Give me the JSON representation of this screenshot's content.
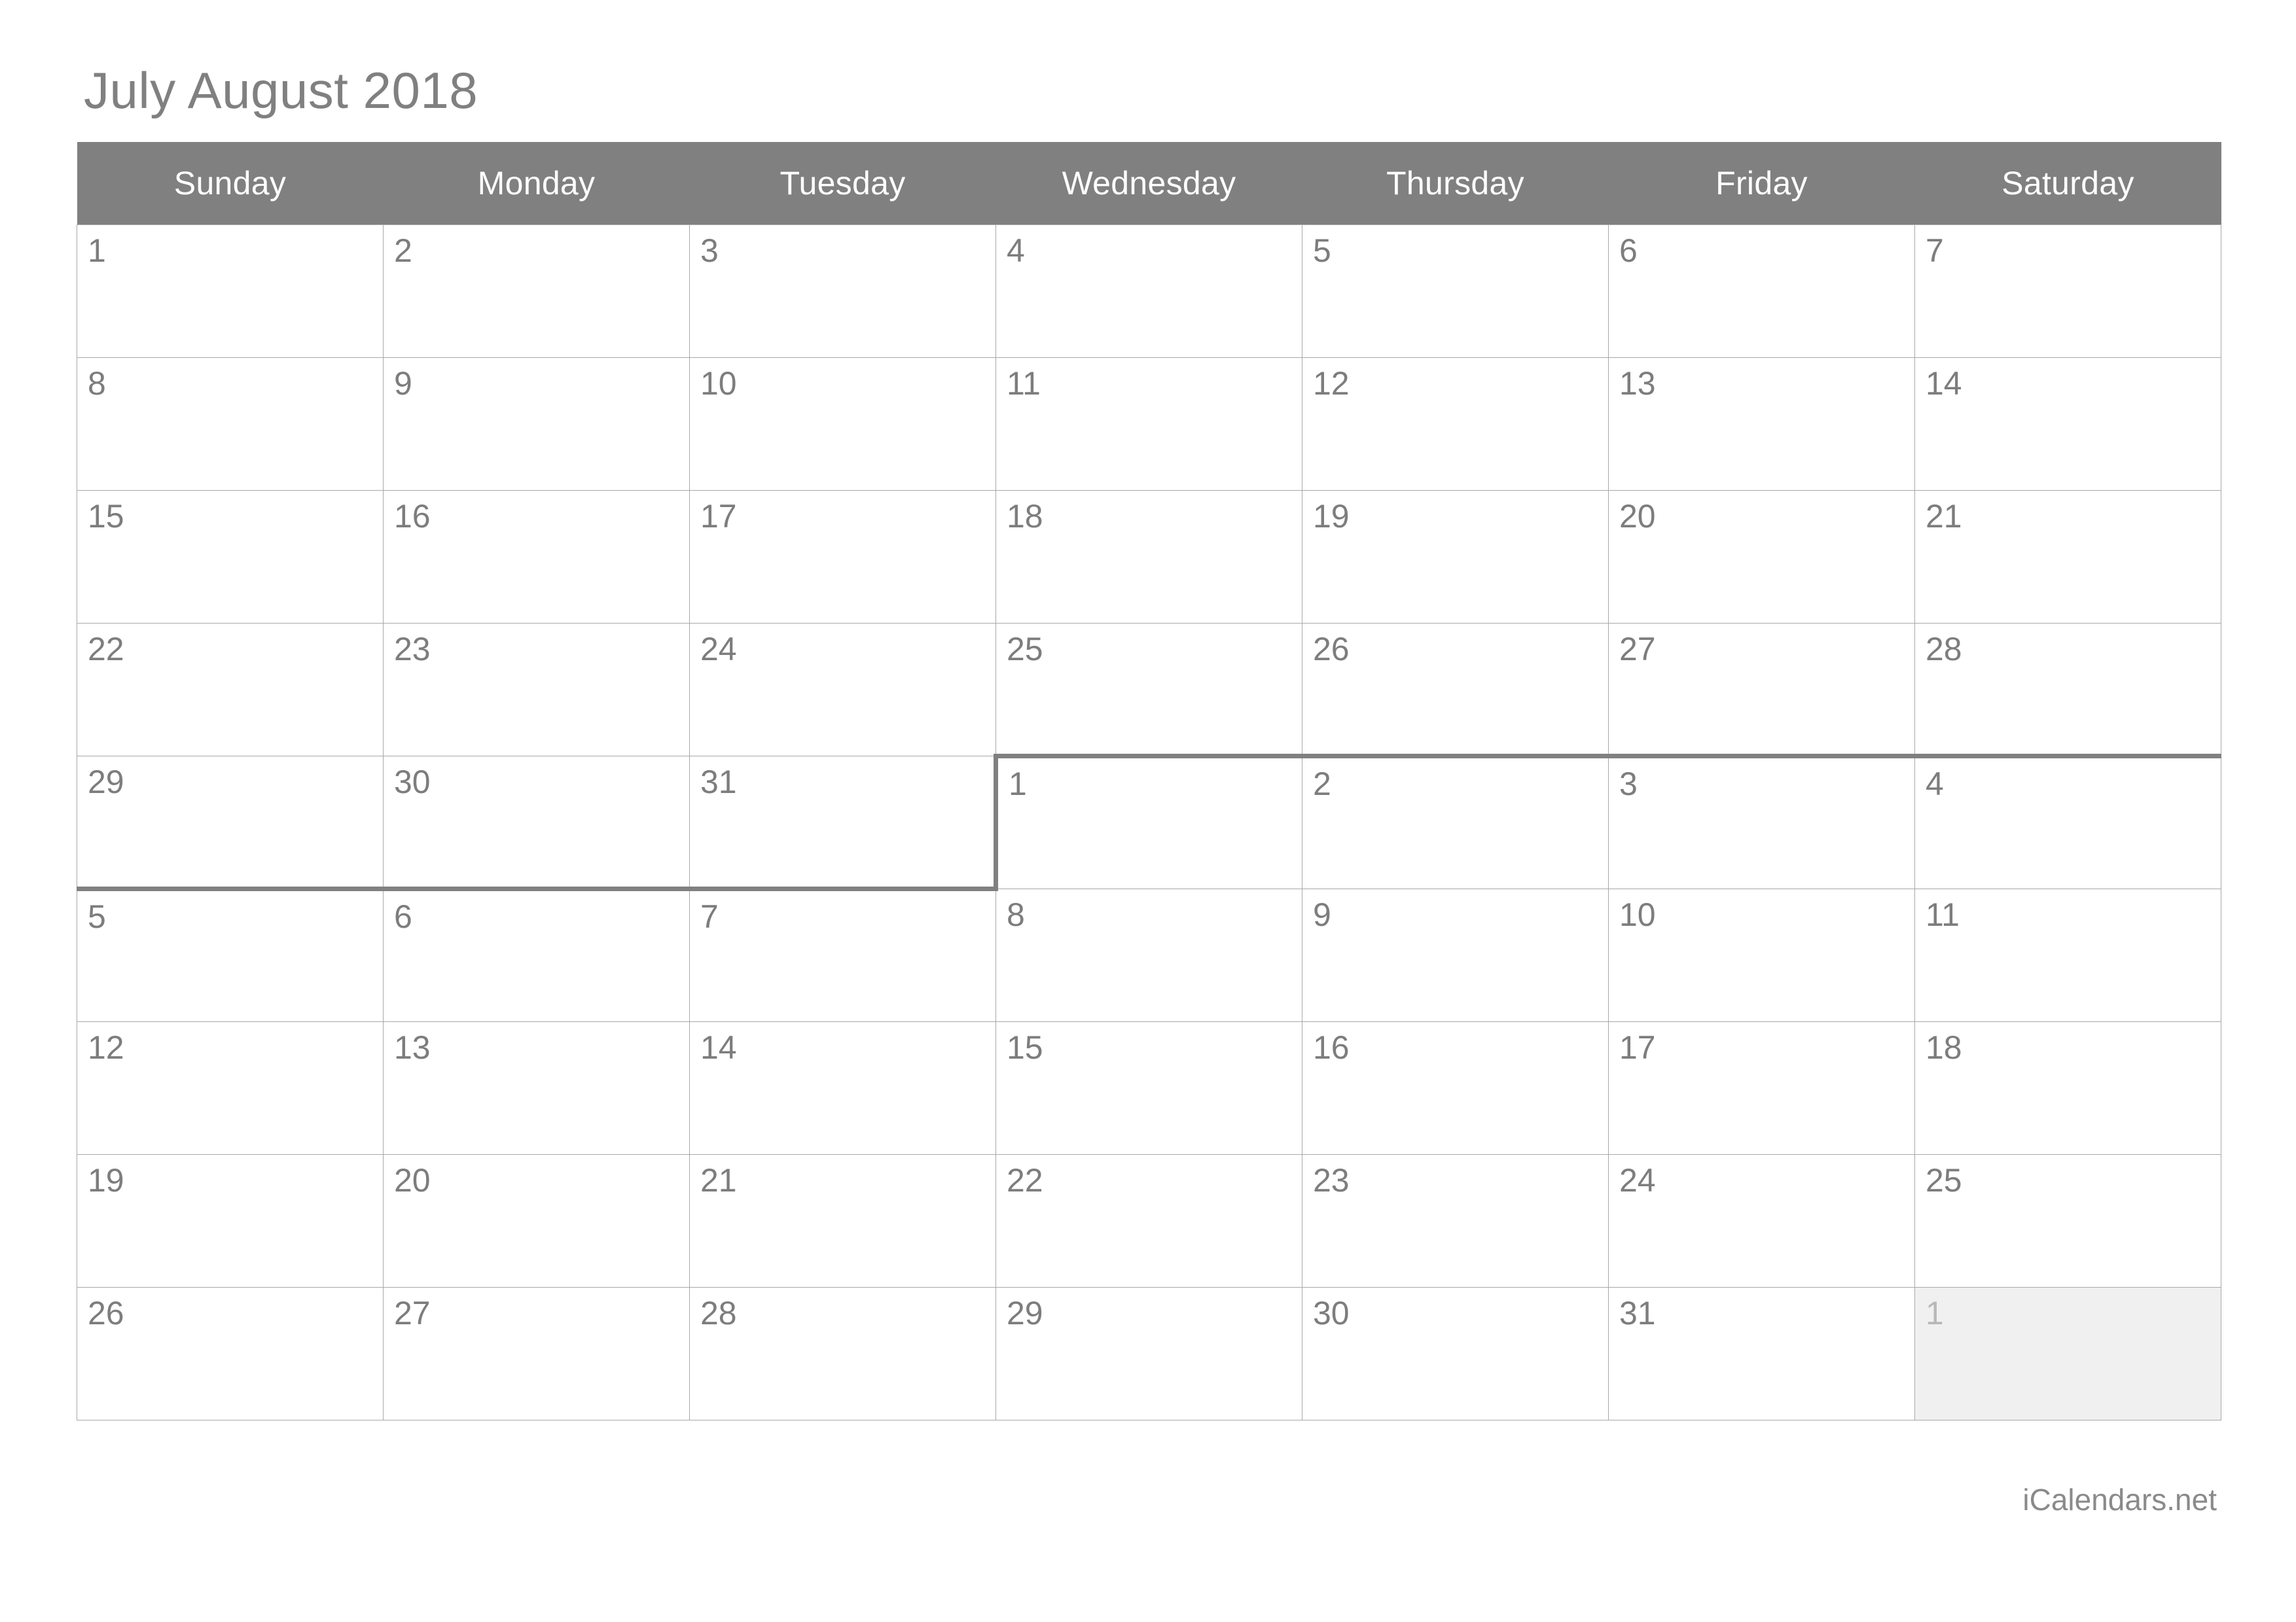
{
  "title": "July August 2018",
  "footer": "iCalendars.net",
  "colors": {
    "header_bg": "#808080",
    "header_text": "#ffffff",
    "day_text": "#7d7d7d",
    "out_day_bg": "#f0f0f0",
    "out_day_text": "#b8b8b8",
    "grid_line": "#a8a8a8",
    "month_boundary": "#808080",
    "title_text": "#808080",
    "footer_text": "#8a8a8a"
  },
  "weekdays": [
    "Sunday",
    "Monday",
    "Tuesday",
    "Wednesday",
    "Thursday",
    "Friday",
    "Saturday"
  ],
  "weeks": [
    [
      {
        "day": "1"
      },
      {
        "day": "2"
      },
      {
        "day": "3"
      },
      {
        "day": "4"
      },
      {
        "day": "5"
      },
      {
        "day": "6"
      },
      {
        "day": "7"
      }
    ],
    [
      {
        "day": "8"
      },
      {
        "day": "9"
      },
      {
        "day": "10"
      },
      {
        "day": "11"
      },
      {
        "day": "12"
      },
      {
        "day": "13"
      },
      {
        "day": "14"
      }
    ],
    [
      {
        "day": "15"
      },
      {
        "day": "16"
      },
      {
        "day": "17"
      },
      {
        "day": "18"
      },
      {
        "day": "19"
      },
      {
        "day": "20"
      },
      {
        "day": "21"
      }
    ],
    [
      {
        "day": "22"
      },
      {
        "day": "23"
      },
      {
        "day": "24"
      },
      {
        "day": "25"
      },
      {
        "day": "26"
      },
      {
        "day": "27"
      },
      {
        "day": "28"
      }
    ],
    [
      {
        "day": "29"
      },
      {
        "day": "30"
      },
      {
        "day": "31"
      },
      {
        "day": "1"
      },
      {
        "day": "2"
      },
      {
        "day": "3"
      },
      {
        "day": "4"
      }
    ],
    [
      {
        "day": "5"
      },
      {
        "day": "6"
      },
      {
        "day": "7"
      },
      {
        "day": "8"
      },
      {
        "day": "9"
      },
      {
        "day": "10"
      },
      {
        "day": "11"
      }
    ],
    [
      {
        "day": "12"
      },
      {
        "day": "13"
      },
      {
        "day": "14"
      },
      {
        "day": "15"
      },
      {
        "day": "16"
      },
      {
        "day": "17"
      },
      {
        "day": "18"
      }
    ],
    [
      {
        "day": "19"
      },
      {
        "day": "20"
      },
      {
        "day": "21"
      },
      {
        "day": "22"
      },
      {
        "day": "23"
      },
      {
        "day": "24"
      },
      {
        "day": "25"
      }
    ],
    [
      {
        "day": "26"
      },
      {
        "day": "27"
      },
      {
        "day": "28"
      },
      {
        "day": "29"
      },
      {
        "day": "30"
      },
      {
        "day": "31"
      },
      {
        "day": "1",
        "out": true
      }
    ]
  ],
  "month_boundary": {
    "bottom_row": 4,
    "bottom_cols": [
      0,
      1,
      2
    ],
    "top_row": 4,
    "top_cols": [
      3,
      4,
      5,
      6
    ],
    "left_row": 4,
    "left_col": 3
  }
}
